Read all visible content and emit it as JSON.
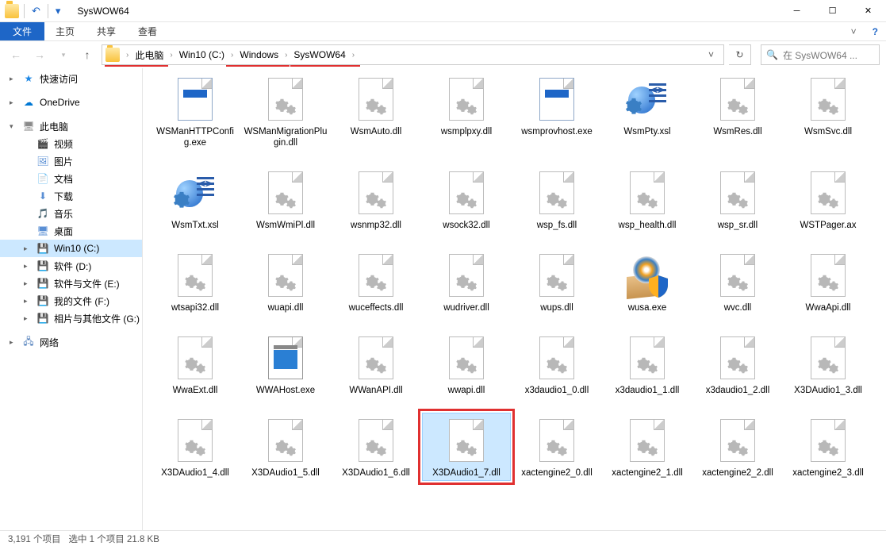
{
  "window": {
    "title": "SysWOW64"
  },
  "ribbon": {
    "file": "文件",
    "tabs": [
      "主页",
      "共享",
      "查看"
    ]
  },
  "nav": {
    "crumbs": [
      "此电脑",
      "Win10 (C:)",
      "Windows",
      "SysWOW64"
    ],
    "search_placeholder": "在 SysWOW64 ..."
  },
  "sidebar": {
    "quick": "快速访问",
    "onedrive": "OneDrive",
    "thispc": "此电脑",
    "pc_children": [
      "视频",
      "图片",
      "文档",
      "下载",
      "音乐",
      "桌面",
      "Win10 (C:)",
      "软件 (D:)",
      "软件与文件 (E:)",
      "我的文件 (F:)",
      "相片与其他文件 (G:)"
    ],
    "network": "网络"
  },
  "files": [
    {
      "name": "WSManHTTPConfig.exe",
      "icon": "exe"
    },
    {
      "name": "WSManMigrationPlugin.dll",
      "icon": "dll"
    },
    {
      "name": "WsmAuto.dll",
      "icon": "dll"
    },
    {
      "name": "wsmplpxy.dll",
      "icon": "dll"
    },
    {
      "name": "wsmprovhost.exe",
      "icon": "exe"
    },
    {
      "name": "WsmPty.xsl",
      "icon": "xsl"
    },
    {
      "name": "WsmRes.dll",
      "icon": "dll"
    },
    {
      "name": "WsmSvc.dll",
      "icon": "dll"
    },
    {
      "name": "WsmTxt.xsl",
      "icon": "xsl"
    },
    {
      "name": "WsmWmiPl.dll",
      "icon": "dll"
    },
    {
      "name": "wsnmp32.dll",
      "icon": "dll"
    },
    {
      "name": "wsock32.dll",
      "icon": "dll"
    },
    {
      "name": "wsp_fs.dll",
      "icon": "dll"
    },
    {
      "name": "wsp_health.dll",
      "icon": "dll"
    },
    {
      "name": "wsp_sr.dll",
      "icon": "dll"
    },
    {
      "name": "WSTPager.ax",
      "icon": "dll"
    },
    {
      "name": "wtsapi32.dll",
      "icon": "dll"
    },
    {
      "name": "wuapi.dll",
      "icon": "dll"
    },
    {
      "name": "wuceffects.dll",
      "icon": "dll"
    },
    {
      "name": "wudriver.dll",
      "icon": "dll"
    },
    {
      "name": "wups.dll",
      "icon": "dll"
    },
    {
      "name": "wusa.exe",
      "icon": "wusa"
    },
    {
      "name": "wvc.dll",
      "icon": "dll"
    },
    {
      "name": "WwaApi.dll",
      "icon": "dll"
    },
    {
      "name": "WwaExt.dll",
      "icon": "dll"
    },
    {
      "name": "WWAHost.exe",
      "icon": "wwahost"
    },
    {
      "name": "WWanAPI.dll",
      "icon": "dll"
    },
    {
      "name": "wwapi.dll",
      "icon": "dll"
    },
    {
      "name": "x3daudio1_0.dll",
      "icon": "dll"
    },
    {
      "name": "x3daudio1_1.dll",
      "icon": "dll"
    },
    {
      "name": "x3daudio1_2.dll",
      "icon": "dll"
    },
    {
      "name": "X3DAudio1_3.dll",
      "icon": "dll"
    },
    {
      "name": "X3DAudio1_4.dll",
      "icon": "dll"
    },
    {
      "name": "X3DAudio1_5.dll",
      "icon": "dll"
    },
    {
      "name": "X3DAudio1_6.dll",
      "icon": "dll"
    },
    {
      "name": "X3DAudio1_7.dll",
      "icon": "dll",
      "selected": true,
      "highlighted": true
    },
    {
      "name": "xactengine2_0.dll",
      "icon": "dll"
    },
    {
      "name": "xactengine2_1.dll",
      "icon": "dll"
    },
    {
      "name": "xactengine2_2.dll",
      "icon": "dll"
    },
    {
      "name": "xactengine2_3.dll",
      "icon": "dll"
    }
  ],
  "status": {
    "count": "3,191 个项目",
    "selection": "选中 1 个项目  21.8 KB"
  }
}
